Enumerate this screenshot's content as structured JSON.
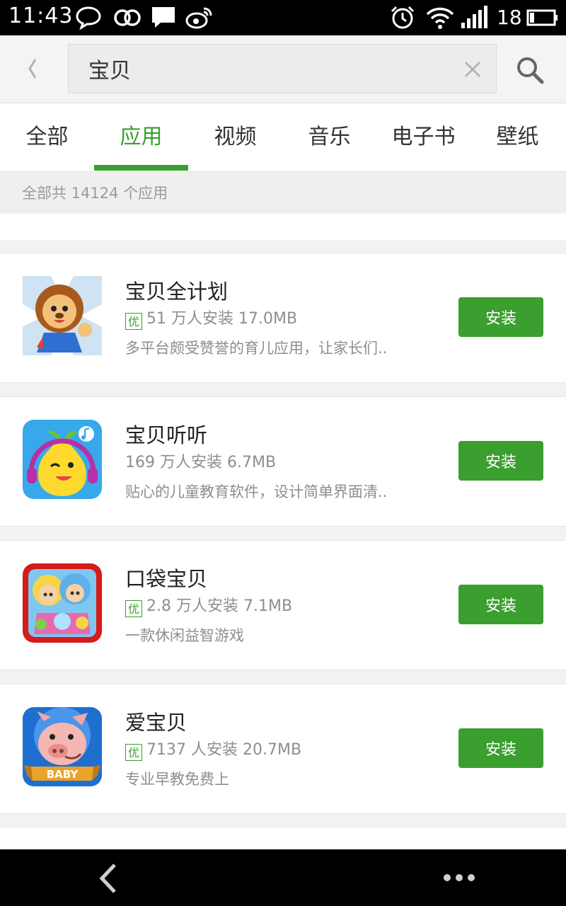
{
  "status_bar": {
    "time": "11:43",
    "battery": "18",
    "icons": [
      "chat-bubble-icon",
      "infinity-icon",
      "message-icon",
      "weibo-icon",
      "alarm-icon",
      "wifi-icon",
      "signal-icon",
      "battery-icon"
    ]
  },
  "search": {
    "query": "宝贝",
    "placeholder": ""
  },
  "tabs": [
    {
      "label": "全部"
    },
    {
      "label": "应用"
    },
    {
      "label": "视频"
    },
    {
      "label": "音乐"
    },
    {
      "label": "电子书"
    },
    {
      "label": "壁纸"
    }
  ],
  "active_tab": "应用",
  "result_count": "全部共 14124 个应用",
  "badge_label": "优",
  "apps": [
    {
      "name": "宝贝全计划",
      "has_badge": true,
      "meta": "51 万人安装  17.0MB",
      "desc": "多平台颇受赞誉的育儿应用，让家长们..",
      "install_label": "安装"
    },
    {
      "name": "宝贝听听",
      "has_badge": false,
      "meta": "169 万人安装  6.7MB",
      "desc": "贴心的儿童教育软件，设计简单界面清..",
      "install_label": "安装"
    },
    {
      "name": "口袋宝贝",
      "has_badge": true,
      "meta": "2.8 万人安装  7.1MB",
      "desc": "一款休闲益智游戏",
      "install_label": "安装"
    },
    {
      "name": "爱宝贝",
      "has_badge": true,
      "meta": "7137 人安装  20.7MB",
      "desc": "专业早教免费上",
      "install_label": "安装",
      "icon_text": "BABY"
    }
  ],
  "colors": {
    "accent": "#3a9f2e",
    "text_primary": "#222222",
    "text_secondary": "#8e8e8e"
  }
}
